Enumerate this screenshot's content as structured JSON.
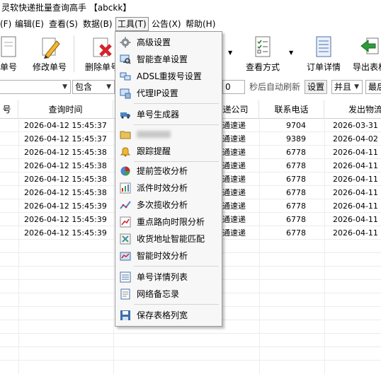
{
  "window": {
    "title": "灵软快递批量查询高手 【abckk】"
  },
  "menubar": {
    "items": [
      "(F)",
      "编辑(E)",
      "查看(S)",
      "数据(B)",
      "工具(T)",
      "公告(X)",
      "帮助(H)"
    ],
    "active_item": "工具(T)"
  },
  "toolbar": {
    "buttons": [
      "单号",
      "修改单号",
      "删除单号",
      "查看方式",
      "订单详情",
      "导出表格"
    ]
  },
  "filterbar": {
    "field_value": "",
    "match_mode": "包含",
    "interval_value": "0",
    "interval_suffix": "秒后自动刷新",
    "settings_label": "设置",
    "logic": "并且",
    "last_select": "最后"
  },
  "table": {
    "columns": [
      "号",
      "查询时间",
      "递公司",
      "联系电话",
      "发出物流"
    ],
    "rows": [
      {
        "time": "2026-04-12 15:45:37",
        "company": "通速递",
        "phone": "9704",
        "ship": "2026-03-31"
      },
      {
        "time": "2026-04-12 15:45:37",
        "company": "通速递",
        "phone": "9389",
        "ship": "2026-04-02"
      },
      {
        "time": "2026-04-12 15:45:38",
        "company": "通速递",
        "phone": "6778",
        "ship": "2026-04-11"
      },
      {
        "time": "2026-04-12 15:45:38",
        "company": "通速递",
        "phone": "6778",
        "ship": "2026-04-11"
      },
      {
        "time": "2026-04-12 15:45:38",
        "company": "通速递",
        "phone": "6778",
        "ship": "2026-04-11"
      },
      {
        "time": "2026-04-12 15:45:38",
        "company": "通速递",
        "phone": "6778",
        "ship": "2026-04-11"
      },
      {
        "time": "2026-04-12 15:45:39",
        "company": "通速递",
        "phone": "6778",
        "ship": "2026-04-11"
      },
      {
        "time": "2026-04-12 15:45:39",
        "company": "通速递",
        "phone": "6778",
        "ship": "2026-04-11"
      },
      {
        "time": "2026-04-12 15:45:39",
        "company": "通速递",
        "phone": "6778",
        "ship": "2026-04-11"
      }
    ]
  },
  "tools_menu": {
    "items": [
      {
        "label": "高级设置",
        "icon": "gear-icon"
      },
      {
        "label": "智能查单设置",
        "icon": "computer-search-icon"
      },
      {
        "label": "ADSL重拨号设置",
        "icon": "network-icon"
      },
      {
        "label": "代理IP设置",
        "icon": "proxy-icon"
      },
      {
        "label": "单号生成器",
        "icon": "truck-icon"
      },
      {
        "label": "",
        "icon": "folder-icon"
      },
      {
        "label": "跟踪提醒",
        "icon": "bell-icon"
      },
      {
        "label": "提前签收分析",
        "icon": "pie-chart-icon"
      },
      {
        "label": "派件时效分析",
        "icon": "bar-chart-icon"
      },
      {
        "label": "多次揽收分析",
        "icon": "line-chart-icon"
      },
      {
        "label": "重点路向时限分析",
        "icon": "route-icon"
      },
      {
        "label": "收货地址智能匹配",
        "icon": "address-match-icon"
      },
      {
        "label": "智能时效分析",
        "icon": "timer-chart-icon"
      },
      {
        "label": "单号详情列表",
        "icon": "list-icon"
      },
      {
        "label": "网络备忘录",
        "icon": "memo-icon"
      },
      {
        "label": "保存表格列宽",
        "icon": "save-icon"
      }
    ]
  }
}
